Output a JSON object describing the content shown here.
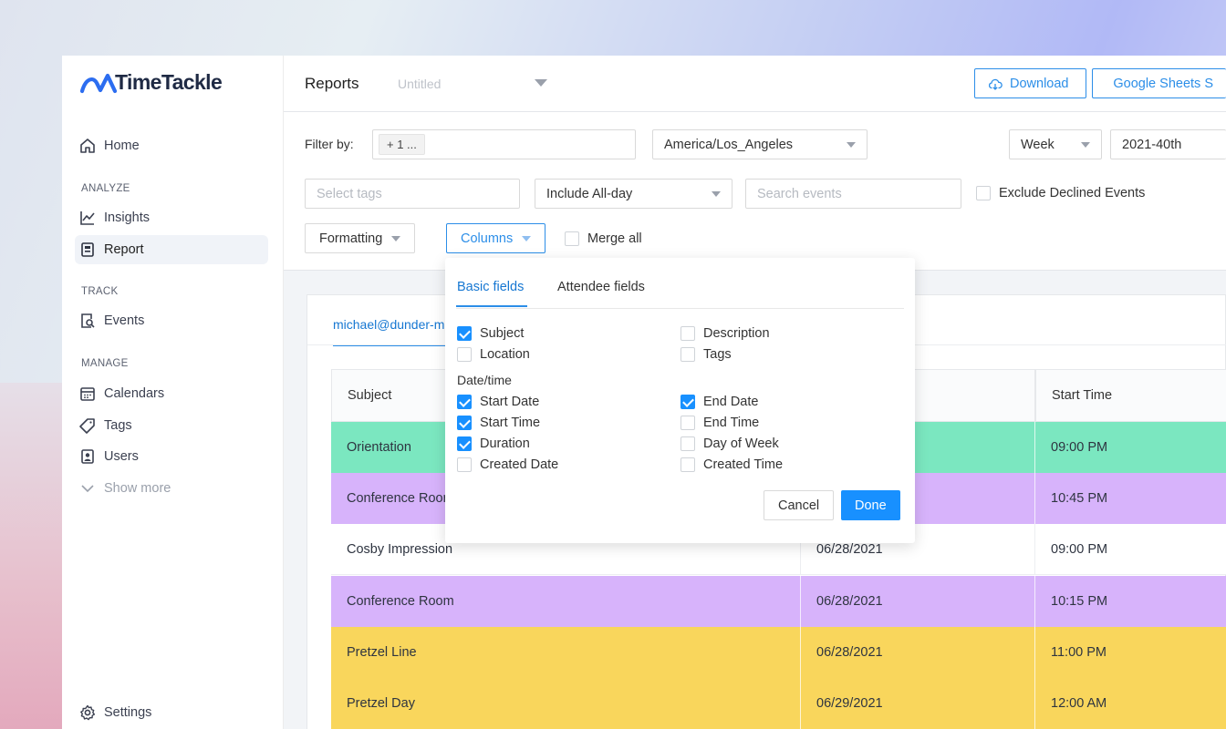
{
  "brand": {
    "name": "TimeTackle",
    "accent": "#2c8ee8"
  },
  "sidebar": {
    "home": "Home",
    "sections": {
      "analyze": "ANALYZE",
      "track": "TRACK",
      "manage": "MANAGE"
    },
    "items": {
      "insights": "Insights",
      "report": "Report",
      "events": "Events",
      "calendars": "Calendars",
      "tags": "Tags",
      "users": "Users",
      "show_more": "Show more"
    },
    "settings": "Settings"
  },
  "topbar": {
    "title": "Reports",
    "report_name": "Untitled",
    "download": "Download",
    "google_sheets": "Google Sheets S"
  },
  "filters": {
    "filter_by_label": "Filter by:",
    "filter_chip": "+ 1 ...",
    "timezone": "America/Los_Angeles",
    "period": "Week",
    "period_value": "2021-40th",
    "tags_placeholder": "Select tags",
    "all_day": "Include All-day",
    "search_placeholder": "Search events",
    "exclude_declined": "Exclude Declined Events",
    "formatting": "Formatting",
    "columns": "Columns",
    "merge_all": "Merge all"
  },
  "card": {
    "user_tab": "michael@dunder-mifflin.com"
  },
  "table": {
    "headers": [
      "Subject",
      "",
      "Start Time"
    ],
    "rows": [
      {
        "subject": "Orientation",
        "date": "",
        "time": "09:00 PM",
        "color": "#7be7c0"
      },
      {
        "subject": "Conference Room",
        "date": "",
        "time": "10:45 PM",
        "color": "#d7b3fb"
      },
      {
        "subject": "Cosby Impression",
        "date": "06/28/2021",
        "time": "09:00 PM",
        "color": "#ffffff"
      },
      {
        "subject": "Conference Room",
        "date": "06/28/2021",
        "time": "10:15 PM",
        "color": "#d7b3fb"
      },
      {
        "subject": "Pretzel Line",
        "date": "06/28/2021",
        "time": "11:00 PM",
        "color": "#f9d65c"
      },
      {
        "subject": "Pretzel Day",
        "date": "06/29/2021",
        "time": "12:00 AM",
        "color": "#f9d65c"
      }
    ]
  },
  "columns_panel": {
    "tabs": [
      "Basic fields",
      "Attendee fields"
    ],
    "basic_top": [
      {
        "label": "Subject",
        "checked": true
      },
      {
        "label": "Description",
        "checked": false
      },
      {
        "label": "Location",
        "checked": false
      },
      {
        "label": "Tags",
        "checked": false
      }
    ],
    "datetime_label": "Date/time",
    "datetime": [
      {
        "label": "Start Date",
        "checked": true
      },
      {
        "label": "End Date",
        "checked": true
      },
      {
        "label": "Start Time",
        "checked": true
      },
      {
        "label": "End Time",
        "checked": false
      },
      {
        "label": "Duration",
        "checked": true
      },
      {
        "label": "Day of Week",
        "checked": false
      },
      {
        "label": "Created Date",
        "checked": false
      },
      {
        "label": "Created Time",
        "checked": false
      }
    ],
    "cancel": "Cancel",
    "done": "Done"
  }
}
